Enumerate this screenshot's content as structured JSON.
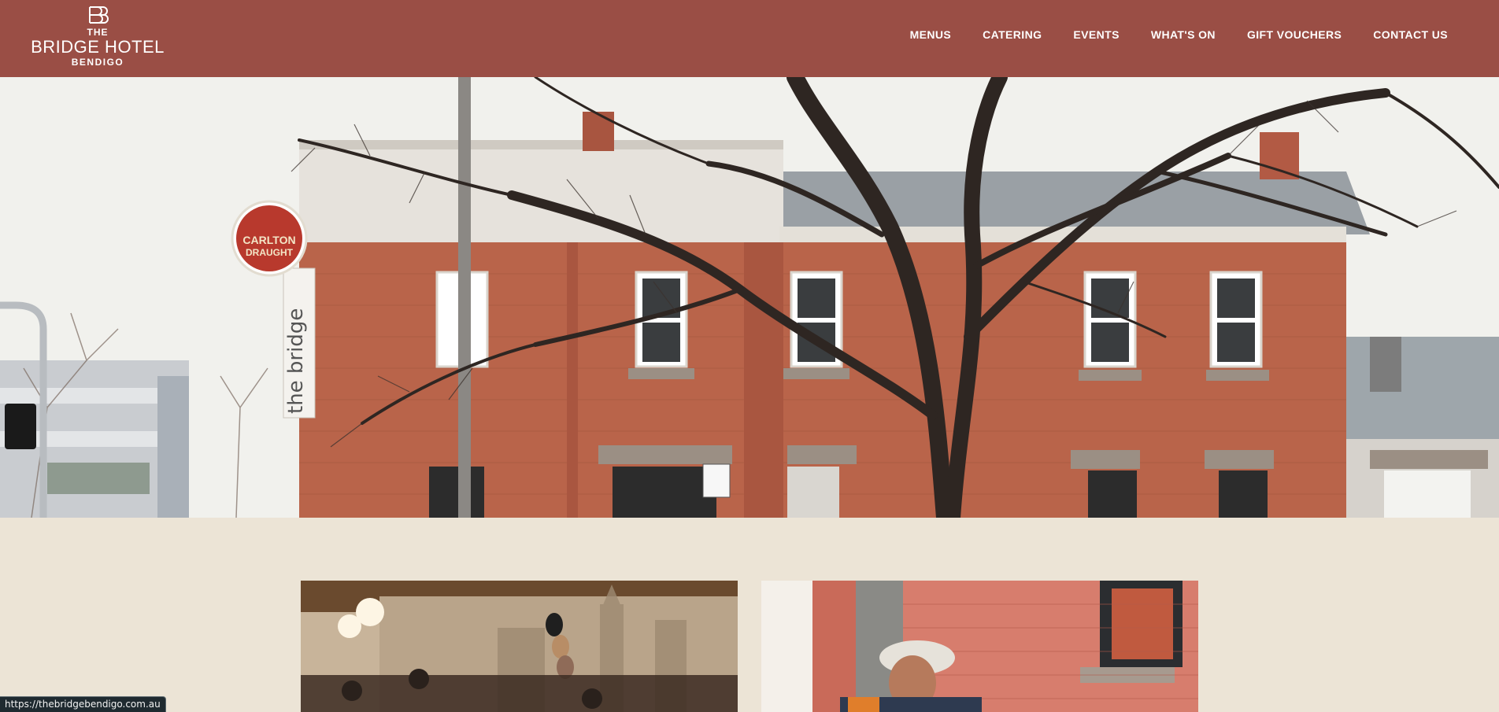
{
  "header": {
    "logo": {
      "line1": "THE",
      "line2": "BRIDGE HOTEL",
      "line3": "BENDIGO"
    },
    "nav": [
      {
        "label": "MENUS"
      },
      {
        "label": "CATERING"
      },
      {
        "label": "EVENTS"
      },
      {
        "label": "WHAT'S ON"
      },
      {
        "label": "GIFT VOUCHERS"
      },
      {
        "label": "CONTACT US"
      }
    ]
  },
  "hero": {
    "sign_text": "the bridge",
    "badge_line1": "CARLTON",
    "badge_line2": "DRAUGHT"
  },
  "status_bar": {
    "url": "https://thebridgebendigo.com.au"
  },
  "colors": {
    "header_bg": "#9a4e45",
    "page_bg": "#ece4d6",
    "brick": "#b9644a"
  }
}
